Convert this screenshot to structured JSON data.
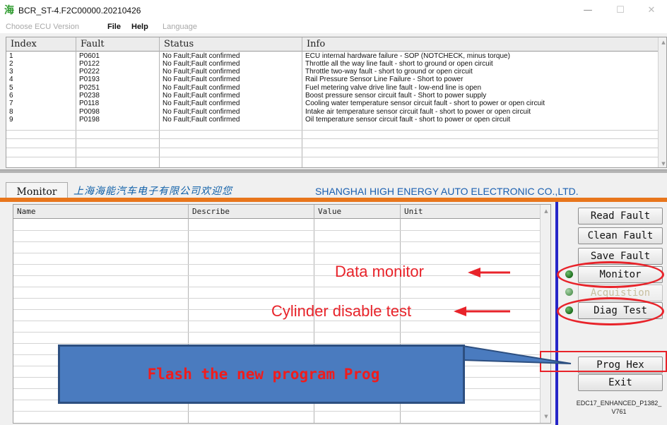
{
  "window": {
    "icon_glyph": "海",
    "title": "BCR_ST-4.F2C00000.20210426",
    "min_glyph": "—",
    "max_glyph": "☐",
    "close_glyph": "✕"
  },
  "menu": {
    "items": [
      {
        "label": "Choose ECU Version",
        "enabled": false
      },
      {
        "label": "File",
        "enabled": true
      },
      {
        "label": "Help",
        "enabled": true
      },
      {
        "label": "Language",
        "enabled": false
      }
    ]
  },
  "fault_table": {
    "columns": [
      "Index",
      "Fault",
      "Status",
      "Info"
    ],
    "rows": [
      {
        "index": "1",
        "fault": "P0601",
        "status": "No Fault;Fault confirmed",
        "info": "ECU internal hardware failure - SOP (NOTCHECK, minus torque)"
      },
      {
        "index": "2",
        "fault": "P0122",
        "status": "No Fault;Fault confirmed",
        "info": "Throttle all the way line fault - short to ground or open circuit"
      },
      {
        "index": "3",
        "fault": "P0222",
        "status": "No Fault;Fault confirmed",
        "info": "Throttle two-way fault - short to ground or open circuit"
      },
      {
        "index": "4",
        "fault": "P0193",
        "status": "No Fault;Fault confirmed",
        "info": "Rail Pressure Sensor Line Failure - Short to power"
      },
      {
        "index": "5",
        "fault": "P0251",
        "status": "No Fault;Fault confirmed",
        "info": "Fuel metering valve drive line fault - low-end line is open"
      },
      {
        "index": "6",
        "fault": "P0238",
        "status": "No Fault;Fault confirmed",
        "info": "Boost pressure sensor circuit fault - Short to power supply"
      },
      {
        "index": "7",
        "fault": "P0118",
        "status": "No Fault;Fault confirmed",
        "info": "Cooling water temperature sensor circuit fault - short to power or open circuit"
      },
      {
        "index": "8",
        "fault": "P0098",
        "status": "No Fault;Fault confirmed",
        "info": "Intake air temperature sensor circuit fault - short to power or open circuit"
      },
      {
        "index": "9",
        "fault": "P0198",
        "status": "No Fault;Fault confirmed",
        "info": "Oil temperature sensor circuit fault - short to power or open circuit"
      }
    ]
  },
  "tab": {
    "monitor_label": "Monitor",
    "cn_banner": "上海海能汽车电子有限公司欢迎您",
    "en_banner": "SHANGHAI HIGH ENERGY AUTO ELECTRONIC CO.,LTD."
  },
  "monitor_table": {
    "columns": [
      "Name",
      "Describe",
      "Value",
      "Unit"
    ]
  },
  "buttons": {
    "read_fault": "Read Fault",
    "clean_fault": "Clean Fault",
    "save_fault": "Save Fault",
    "monitor": "Monitor",
    "acquisition": "Acquistion",
    "diag_test": "Diag Test",
    "prog_hex": "Prog Hex",
    "exit": "Exit"
  },
  "version_label_line1": "EDC17_ENHANCED_P1382_",
  "version_label_line2": "V761",
  "annotations": {
    "data_monitor": "Data monitor",
    "cylinder_disable": "Cylinder disable test",
    "flash_program": "Flash the new program Prog"
  },
  "colors": {
    "annotation_red": "#e8232a",
    "banner_orange": "#e8761c",
    "callout_blue": "#4a7bbf",
    "separator_blue": "#2626c8",
    "banner_text_blue": "#1a5fb0"
  }
}
